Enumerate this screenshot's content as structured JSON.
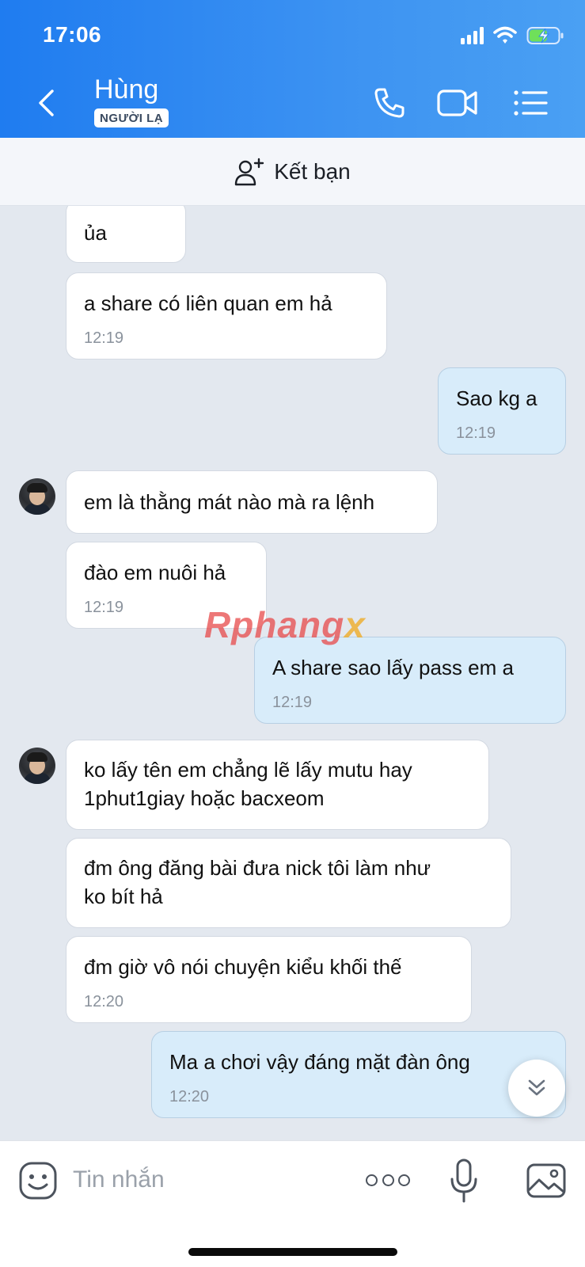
{
  "status": {
    "time": "17:06"
  },
  "header": {
    "contact_name": "Hùng",
    "badge": "NGƯỜI LẠ"
  },
  "friend_bar": {
    "label": "Kết bạn"
  },
  "messages": [
    {
      "dir": "in",
      "text": "ủa",
      "time": ""
    },
    {
      "dir": "in",
      "text": "a share có liên quan em hả",
      "time": "12:19"
    },
    {
      "dir": "out",
      "text": "Sao kg a",
      "time": "12:19"
    },
    {
      "dir": "in",
      "text": "em là thằng mát nào mà ra lệnh",
      "time": ""
    },
    {
      "dir": "in",
      "text": "đào em nuôi hả",
      "time": "12:19"
    },
    {
      "dir": "out",
      "text": "A share sao lấy pass em a",
      "time": "12:19"
    },
    {
      "dir": "in",
      "text": "ko lấy tên em chẳng lẽ lấy mutu hay\n1phut1giay hoặc bacxeom",
      "time": ""
    },
    {
      "dir": "in",
      "text": "đm ông đăng bài đưa nick tôi làm như\nko bít hả",
      "time": ""
    },
    {
      "dir": "in",
      "text": "đm giờ vô nói chuyện kiểu khối thế",
      "time": "12:20"
    },
    {
      "dir": "out",
      "text": "Ma a chơi vậy đáng mặt đàn ông",
      "time": "12:20"
    }
  ],
  "watermark": "Rphangx",
  "composer": {
    "placeholder": "Tin nhắn"
  },
  "colors": {
    "header": "#2f89f2",
    "outgoing_bubble": "#d8ecfa",
    "incoming_bubble": "#ffffff",
    "background": "#e3e8ef"
  }
}
